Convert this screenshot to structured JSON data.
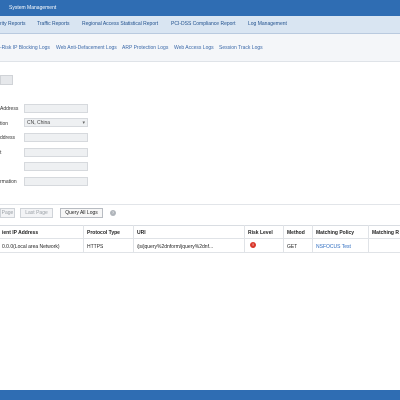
{
  "topbar": {
    "title": "System Management"
  },
  "menu": {
    "items": [
      "rity Reports",
      "Traffic Reports",
      "Regional Access Statistical Report",
      "PCI-DSS Compliance Report",
      "Log Management"
    ]
  },
  "submenu": {
    "items": [
      "-Risk IP Blocking Logs",
      "Web Anti-Defacement Logs",
      "ARP Protection Logs",
      "Web Access Logs",
      "Session Track Logs"
    ]
  },
  "form": {
    "labels": [
      "Address",
      "tion",
      "ddress",
      "t",
      "rmation"
    ],
    "location_value": "CN, China",
    "location_arrow": "▾"
  },
  "pager": {
    "prev_label": "Page",
    "last_label": "Last Page",
    "query_all_label": "Query All Logs",
    "help_glyph": "?"
  },
  "table": {
    "headers": [
      "ient IP Address",
      "Protocol Type",
      "URI",
      "Risk Level",
      "Method",
      "Matching Policy",
      "Matching R"
    ],
    "rows": [
      {
        "client_ip": "0.0.0(Local area Network)",
        "protocol": "HTTPS",
        "uri": "/js/jquery%2dnform/jquery%2dnf...",
        "risk_glyph": "!",
        "method": "GET",
        "policy": "NSFOCUS Test",
        "rule": ""
      }
    ]
  },
  "colors": {
    "brand_blue": "#2f6db3",
    "menu_bg": "#d9e5f2",
    "link": "#2d6cc0",
    "risk_high": "#d9382c"
  }
}
